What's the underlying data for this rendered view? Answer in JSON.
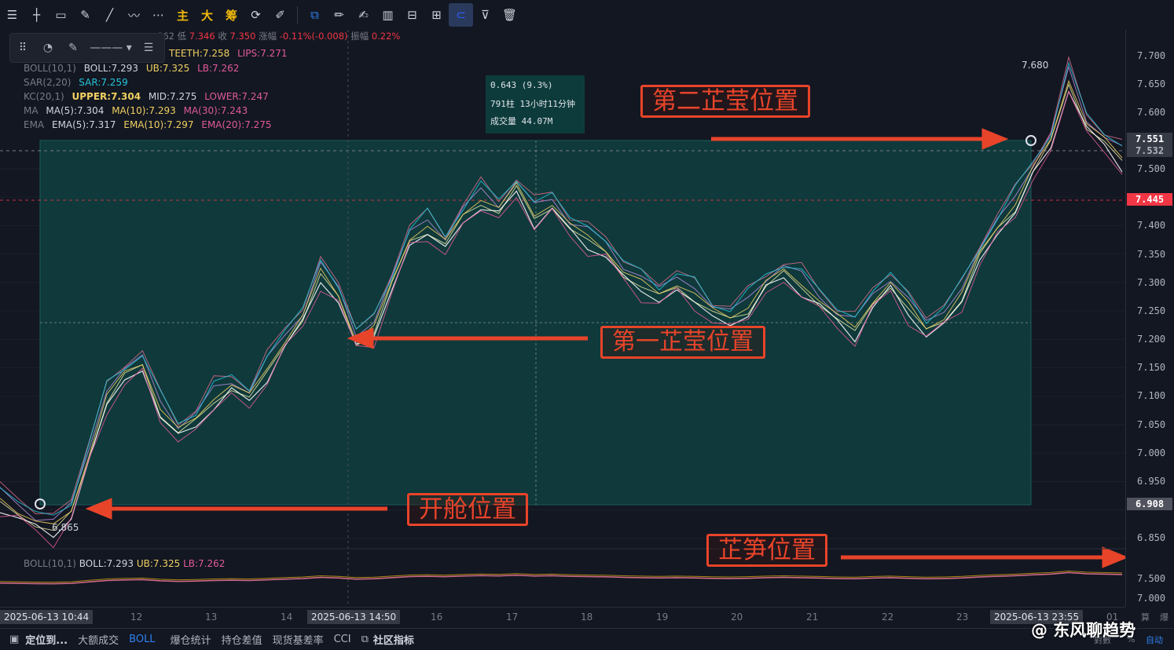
{
  "toolbar": {
    "text_buttons": [
      "主",
      "大",
      "筹"
    ]
  },
  "legend": {
    "ohlc": {
      "low_label": "低",
      "low": "7.346",
      "close_label": "收",
      "close": "7.350",
      "chg_label": "涨幅",
      "chg": "-0.11%(-0.008)",
      "amp_label": "振幅",
      "amp": "0.22%",
      "partial": "862"
    },
    "alligator": {
      "teeth": "TEETH:7.258",
      "lips": "LIPS:7.271"
    },
    "boll_top": {
      "name": "BOLL(10,1)",
      "boll": "BOLL:7.293",
      "ub": "UB:7.325",
      "lb": "LB:7.262"
    },
    "sar": {
      "name": "SAR(2,20)",
      "val": "SAR:7.259"
    },
    "kc": {
      "name": "KC(20,1)",
      "upper": "UPPER:7.304",
      "mid": "MID:7.275",
      "lower": "LOWER:7.247"
    },
    "ma": {
      "name": "MA",
      "ma5": "MA(5):7.304",
      "ma10": "MA(10):7.293",
      "ma30": "MA(30):7.243"
    },
    "ema": {
      "name": "EMA",
      "ema5": "EMA(5):7.317",
      "ema10": "EMA(10):7.297",
      "ema20": "EMA(20):7.275"
    }
  },
  "info_box": {
    "line1": "0.643 (9.3%)",
    "line2": "791柱 13小时11分钟",
    "line3": "成交量 44.07M"
  },
  "annotations": {
    "second": "第二芷莹位置",
    "first": "第一芷莹位置",
    "open": "开舱位置",
    "zhisun": "芷笋位置"
  },
  "marks": {
    "high": "7.680",
    "low": "6.865"
  },
  "price_axis": {
    "labels": [
      "7.700",
      "7.650",
      "7.600",
      "7.500",
      "7.400",
      "7.350",
      "7.300",
      "7.250",
      "7.200",
      "7.150",
      "7.100",
      "7.050",
      "7.000",
      "6.950",
      "6.850"
    ],
    "tag_current": "7.551",
    "tag_current2": "7.532",
    "tag_red": "7.445",
    "tag_low": "6.908",
    "sub_labels": [
      "7.500",
      "7.000"
    ],
    "colors": {
      "current": "#363a45",
      "red": "#f23645",
      "low": "#50535e"
    }
  },
  "sub_pane": {
    "name": "BOLL(10,1)",
    "boll": "BOLL:7.293",
    "ub": "UB:7.325",
    "lb": "LB:7.262"
  },
  "time_axis": {
    "labels": [
      "12",
      "13",
      "14",
      "16",
      "17",
      "18",
      "19",
      "20",
      "21",
      "22",
      "23",
      "01"
    ],
    "tag_left": "2025-06-13 10:44",
    "tag_mid": "2025-06-13 14:50",
    "tag_right": "2025-06-13 23:55",
    "corner_top": "算",
    "corner_bottom": "對數",
    "corner_pct": "%",
    "corner_auto": "自动",
    "corner_right": "爆"
  },
  "bottom_bar": {
    "items": [
      "定位到...",
      "大额成交",
      "BOLL",
      "爆仓统计",
      "持仓差值",
      "现货基差率",
      "CCI",
      "社区指标"
    ]
  },
  "watermark": "@ 东风聊趋势",
  "chart_data": {
    "type": "line",
    "title": "",
    "x_range_labels": [
      "2025-06-13 10:44",
      "2025-06-13 23:55"
    ],
    "y_range": [
      6.85,
      7.7
    ],
    "measure": {
      "start": 6.865,
      "end": 7.551,
      "change": "0.643 (9.3%)"
    },
    "series": [
      {
        "values": [
          6.92,
          6.9,
          6.88,
          6.87,
          6.9,
          7.0,
          7.1,
          7.14,
          7.16,
          7.08,
          7.04,
          7.06,
          7.1,
          7.12,
          7.1,
          7.15,
          7.2,
          7.24,
          7.32,
          7.28,
          7.2,
          7.22,
          7.3,
          7.38,
          7.4,
          7.37,
          7.42,
          7.45,
          7.43,
          7.47,
          7.42,
          7.44,
          7.4,
          7.38,
          7.36,
          7.32,
          7.3,
          7.28,
          7.3,
          7.28,
          7.25,
          7.24,
          7.26,
          7.3,
          7.32,
          7.3,
          7.27,
          7.24,
          7.22,
          7.27,
          7.3,
          7.26,
          7.22,
          7.24,
          7.28,
          7.35,
          7.4,
          7.44,
          7.5,
          7.55,
          7.66,
          7.58,
          7.55,
          7.52
        ]
      }
    ]
  }
}
